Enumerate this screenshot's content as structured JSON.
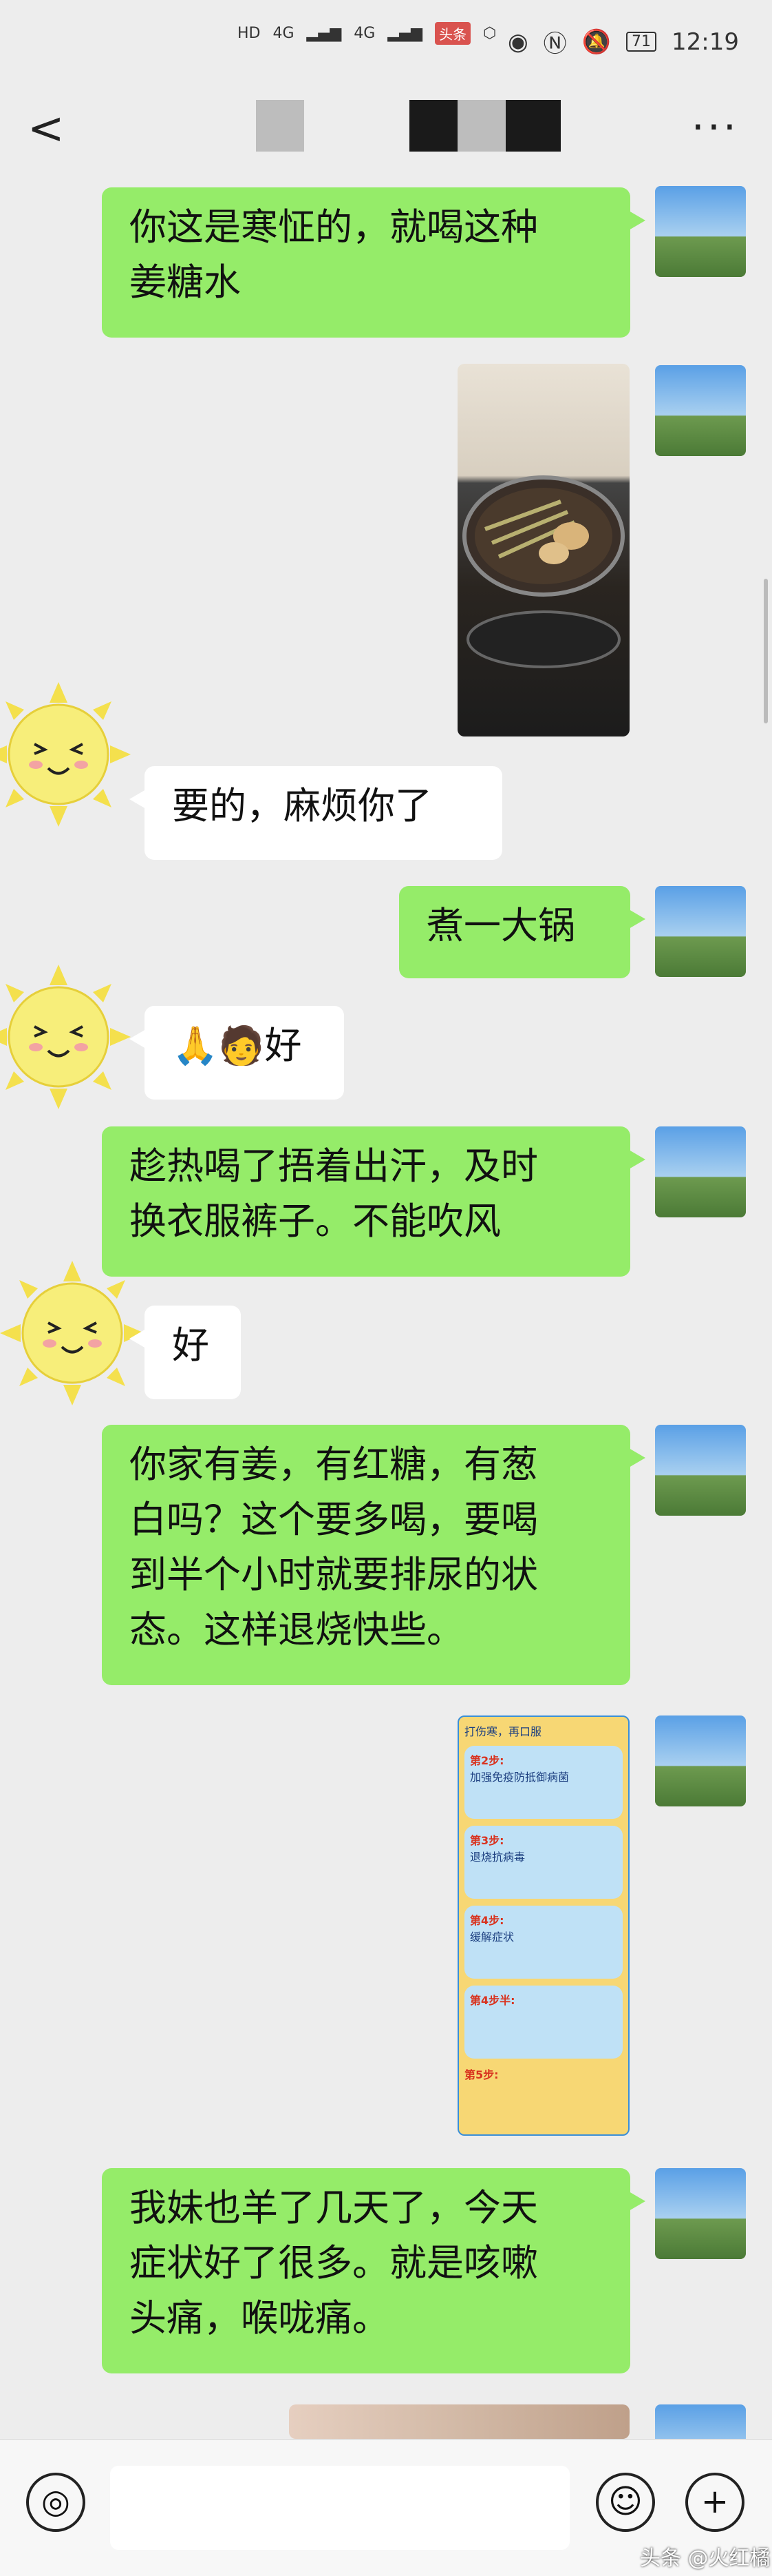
{
  "status_bar": {
    "hd1": "HD",
    "hd2": "HD",
    "net1": "4G",
    "net2": "4G",
    "app_badge": "头条",
    "battery": "71",
    "time": "12:19"
  },
  "nav": {
    "back_icon": "chevron-left-icon",
    "more_label": "···"
  },
  "messages": [
    {
      "side": "me",
      "text": "你这是寒怔的，就喝这种\n姜糖水"
    },
    {
      "side": "me",
      "type": "image",
      "alt": "pot-of-ginger-water"
    },
    {
      "side": "other",
      "text": "要的，麻烦你了"
    },
    {
      "side": "me",
      "text": "煮一大锅"
    },
    {
      "side": "other",
      "text": "🙏🧑好"
    },
    {
      "side": "me",
      "text": "趁热喝了捂着出汗，及时\n换衣服裤子。不能吹风"
    },
    {
      "side": "other",
      "text": "好"
    },
    {
      "side": "me",
      "text": "你家有姜，有红糖，有葱\n白吗？这个要多喝，要喝\n到半个小时就要排尿的状\n态。这样退烧快些。"
    },
    {
      "side": "me",
      "type": "image",
      "alt": "step-guide-infographic"
    },
    {
      "side": "me",
      "text": "我妹也羊了几天了，今天\n症状好了很多。就是咳嗽\n头痛，喉咙痛。"
    }
  ],
  "infographic": {
    "lines": [
      "打伤寒，再口服",
      "第2步:",
      "加强免疫防抵御病菌",
      "第3步:",
      "退烧抗病毒",
      "第4步:",
      "缓解症状",
      "第4步半:",
      "第5步:"
    ]
  },
  "bottom": {
    "voice_icon": "voice-icon",
    "emoji_icon": "emoji-icon",
    "plus_icon": "plus-icon",
    "emoji_label": "☺",
    "plus_label": "+",
    "voice_label": "◎"
  },
  "watermark": "头条 @火红橘"
}
